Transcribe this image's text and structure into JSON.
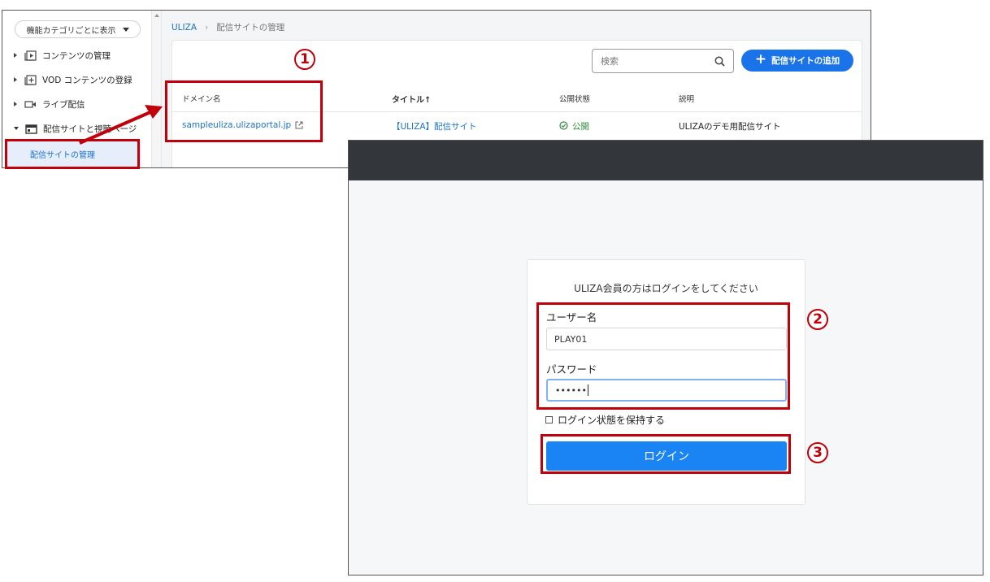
{
  "admin": {
    "sidebar": {
      "category_select": "機能カテゴリごとに表示",
      "items": [
        {
          "label": "コンテンツの管理",
          "icon": "play-box-icon"
        },
        {
          "label": "VOD コンテンツの登録",
          "icon": "add-box-icon"
        },
        {
          "label": "ライブ配信",
          "icon": "video-camera-icon"
        },
        {
          "label": "配信サイトと視聴ページ",
          "icon": "site-window-icon"
        }
      ],
      "sub_item": "配信サイトの管理"
    },
    "breadcrumb": {
      "root": "ULIZA",
      "separator": "›",
      "current": "配信サイトの管理"
    },
    "search_placeholder": "検索",
    "add_button": "配信サイトの追加",
    "table": {
      "headers": [
        "ドメイン名",
        "タイトル",
        "公開状態",
        "説明"
      ],
      "sort_indicator": "↑",
      "row": {
        "domain": "sampleuliza.ulizaportal.jp",
        "title": "【ULIZA】配信サイト",
        "status": "公開",
        "description": "ULIZAのデモ用配信サイト"
      }
    }
  },
  "login": {
    "message": "ULIZA会員の方はログインをしてください",
    "username_label": "ユーザー名",
    "username_value": "PLAY01",
    "password_label": "パスワード",
    "password_value": "••••••",
    "remember_label": "ログイン状態を保持する",
    "submit": "ログイン"
  },
  "callouts": {
    "step1": "1",
    "step2": "2",
    "step3": "3"
  },
  "colors": {
    "accent_blue": "#1a73e8",
    "callout_red": "#c0000a",
    "topbar": "#33363b"
  }
}
